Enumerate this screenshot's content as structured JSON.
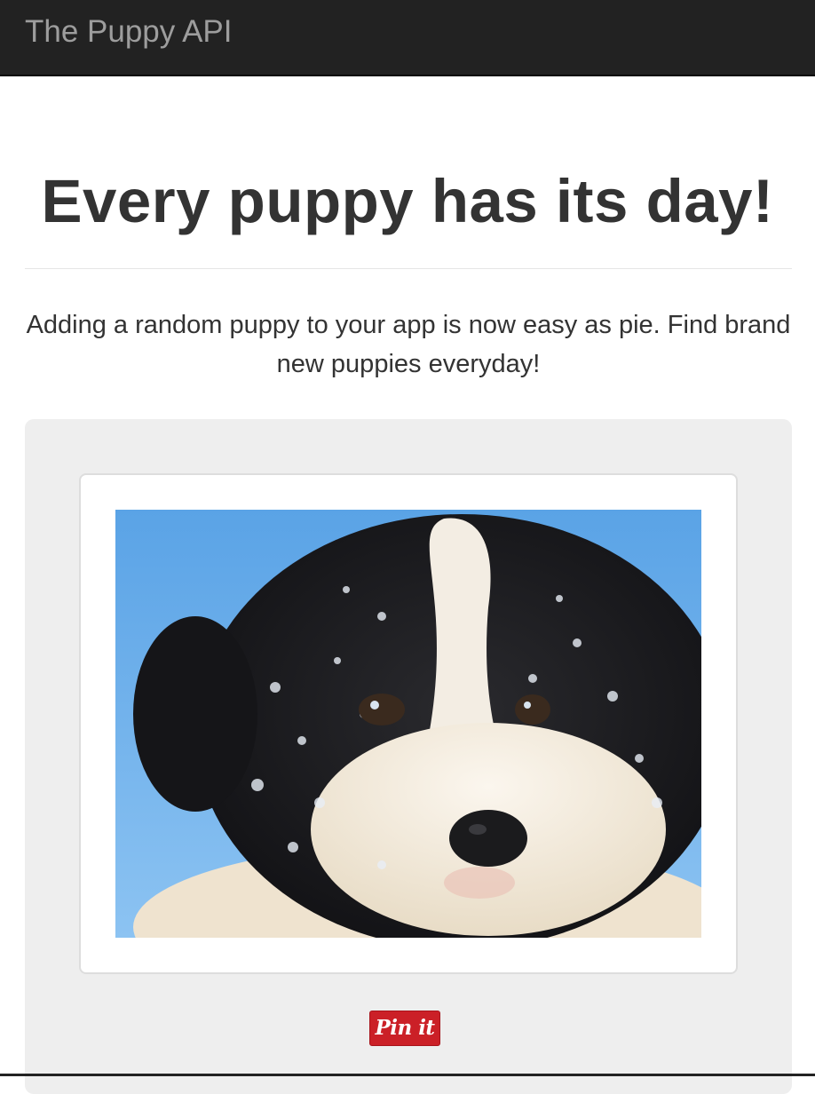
{
  "navbar": {
    "brand": "The Puppy API"
  },
  "hero": {
    "headline": "Every puppy has its day!",
    "lead": "Adding a random puppy to your app is now easy as pie. Find brand new puppies everyday!"
  },
  "card": {
    "pin_label": "Pin it"
  },
  "colors": {
    "navbar_bg": "#222222",
    "brand_text": "#9d9d9d",
    "well_bg": "#eeeeee",
    "pin_red": "#cb2027"
  }
}
